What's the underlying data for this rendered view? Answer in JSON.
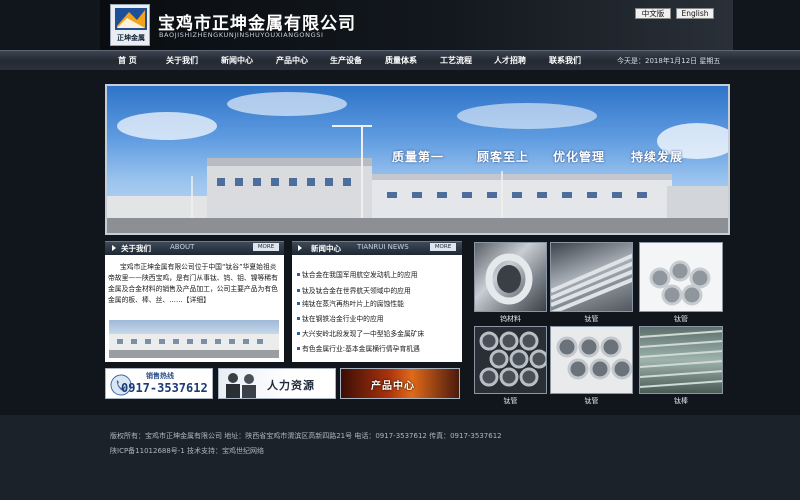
{
  "header": {
    "company_name": "宝鸡市正坤金属有限公司",
    "company_pinyin": "BAOJISHIZHENGKUNJINSHUYOUXIANGONGSI",
    "logo_text": "正坤金属",
    "lang_cn": "中文版",
    "lang_en": "English"
  },
  "nav": {
    "items": [
      "首 页",
      "关于我们",
      "新闻中心",
      "产品中心",
      "生产设备",
      "质量体系",
      "工艺流程",
      "人才招聘",
      "联系我们"
    ],
    "date": "今天是：2018年1月12日  星期五"
  },
  "banner": {
    "slogans": [
      "质量第一",
      "顾客至上",
      "优化管理",
      "持续发展"
    ]
  },
  "about": {
    "title": "关于我们",
    "title_en": "ABOUT",
    "more": "MORE",
    "text": "宝鸡市正坤金属有限公司位于中国“钛谷”华夏始祖炎帝故里——陕西宝鸡，是有门从事钛、钨、钼、镍等稀有金属及合金材料的销售及产品加工，公司主要产品为有色金属的板、棒、丝、……【详细】"
  },
  "news": {
    "title": "新闻中心",
    "title_en": "TIANRUI NEWS",
    "more": "MORE",
    "items": [
      "钛合金在我国军用航空发动机上的应用",
      "钛及钛合金在世界航天领域中的应用",
      "纯钛在蒸汽再热叶片上的腐蚀性能",
      "钛在钢铁冶金行业中的应用",
      "大兴安岭北段发现了一中型铅多金属矿床",
      "有色金属行业:基本金属横行倩孕育机遇"
    ]
  },
  "products": {
    "captions": [
      "钨材料",
      "钛管",
      "钛管",
      "钛管",
      "钛管",
      "钛棒"
    ]
  },
  "promo": {
    "hotline_label": "销售热线",
    "hotline_number": "0917-3537612",
    "hr_label": "人力资源",
    "product_center": "产品中心"
  },
  "footer": {
    "line1": "版权所有：宝鸡市正坤金属有限公司  地址：陕西省宝鸡市渭滨区高新四路21号 电话：0917-3537612 传真：0917-3537612",
    "line2": "陕ICP备11012688号-1   技术支持：宝鸡世纪网络"
  }
}
